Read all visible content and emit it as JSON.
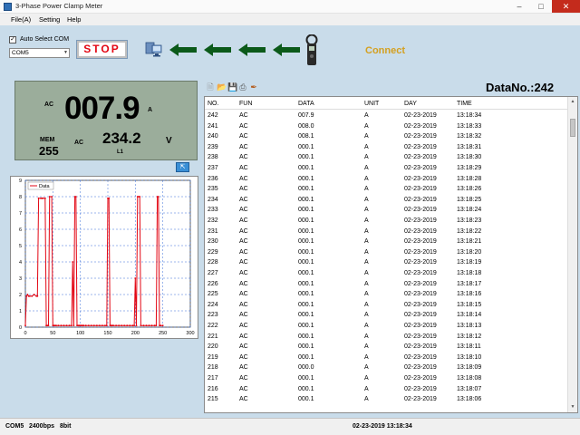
{
  "window": {
    "title": "3-Phase Power Clamp Meter",
    "minimize_icon": "minimize-icon",
    "maximize_icon": "maximize-icon",
    "close_icon": "close-icon"
  },
  "menu": [
    "File(A)",
    "Setting",
    "Help"
  ],
  "toolbar": {
    "auto_select_label": "Auto Select COM",
    "auto_select_checked": true,
    "com_port": "COM5",
    "stop_label": "STOP",
    "connect_label": "Connect",
    "accent_red": "#e30613",
    "arrow_color": "#0b5a1a",
    "connect_color": "#d4a020"
  },
  "meter": {
    "mode": "AC",
    "main_value": "007.9",
    "main_unit": "A",
    "mem_label": "MEM",
    "mem_value": "255",
    "sub_mode": "AC",
    "sub_value": "234.2",
    "sub_unit": "V",
    "phase": "L1"
  },
  "chart_data": {
    "type": "line",
    "legend": [
      "Data"
    ],
    "legend_position": "top-left",
    "xlim": [
      0,
      300
    ],
    "ylim": [
      0,
      9
    ],
    "xticks": [
      "0",
      "50",
      "100",
      "150",
      "200",
      "250",
      "300"
    ],
    "yticks": [
      "0",
      "1",
      "2",
      "3",
      "4",
      "5",
      "6",
      "7",
      "8",
      "9"
    ],
    "grid": true,
    "series": [
      {
        "name": "Data",
        "color": "#e30613",
        "x": [
          0,
          2,
          4,
          6,
          8,
          12,
          16,
          20,
          22,
          24,
          28,
          30,
          32,
          36,
          38,
          40,
          42,
          44,
          48,
          50,
          52,
          54,
          56,
          60,
          65,
          70,
          75,
          80,
          84,
          86,
          88,
          90,
          92,
          94,
          96,
          98,
          100,
          102,
          104,
          106,
          110,
          115,
          120,
          125,
          130,
          135,
          140,
          145,
          148,
          150,
          152,
          154,
          156,
          158,
          160,
          165,
          170,
          175,
          180,
          185,
          190,
          195,
          198,
          200,
          202,
          204,
          206,
          208,
          210,
          215,
          220,
          225,
          230,
          235,
          238,
          240,
          242,
          244,
          246,
          250
        ],
        "y": [
          0.1,
          1.9,
          2.0,
          1.9,
          1.9,
          1.9,
          2.0,
          1.9,
          1.9,
          7.9,
          7.9,
          7.9,
          7.9,
          7.9,
          0.1,
          0.1,
          0.1,
          8.0,
          8.0,
          0.1,
          0.1,
          0.1,
          0.1,
          0.1,
          0.1,
          0.1,
          0.1,
          0.1,
          0.1,
          4.0,
          0.1,
          8.0,
          8.0,
          0.1,
          0.1,
          0.1,
          0.1,
          0.1,
          0.1,
          0.1,
          0.1,
          0.1,
          0.1,
          0.1,
          0.1,
          0.1,
          0.1,
          0.1,
          0.1,
          7.9,
          7.9,
          0.1,
          0.1,
          0.1,
          0.1,
          0.1,
          0.1,
          0.1,
          0.1,
          0.1,
          0.1,
          0.1,
          0.1,
          3.0,
          0.1,
          8.0,
          8.0,
          8.0,
          0.1,
          0.1,
          0.1,
          0.1,
          0.1,
          0.1,
          0.1,
          8.0,
          8.0,
          0.1,
          0.1,
          0.1
        ]
      }
    ]
  },
  "table_toolbar_icons": [
    "new-icon",
    "open-icon",
    "save-icon",
    "print-icon",
    "clear-icon"
  ],
  "data_no": "DataNo.:242",
  "table": {
    "columns": [
      "NO.",
      "FUN",
      "DATA",
      "UNIT",
      "DAY",
      "TIME"
    ],
    "rows": [
      [
        "242",
        "AC",
        "007.9",
        "A",
        "02-23-2019",
        "13:18:34"
      ],
      [
        "241",
        "AC",
        "008.0",
        "A",
        "02-23-2019",
        "13:18:33"
      ],
      [
        "240",
        "AC",
        "008.1",
        "A",
        "02-23-2019",
        "13:18:32"
      ],
      [
        "239",
        "AC",
        "000.1",
        "A",
        "02-23-2019",
        "13:18:31"
      ],
      [
        "238",
        "AC",
        "000.1",
        "A",
        "02-23-2019",
        "13:18:30"
      ],
      [
        "237",
        "AC",
        "000.1",
        "A",
        "02-23-2019",
        "13:18:29"
      ],
      [
        "236",
        "AC",
        "000.1",
        "A",
        "02-23-2019",
        "13:18:28"
      ],
      [
        "235",
        "AC",
        "000.1",
        "A",
        "02-23-2019",
        "13:18:26"
      ],
      [
        "234",
        "AC",
        "000.1",
        "A",
        "02-23-2019",
        "13:18:25"
      ],
      [
        "233",
        "AC",
        "000.1",
        "A",
        "02-23-2019",
        "13:18:24"
      ],
      [
        "232",
        "AC",
        "000.1",
        "A",
        "02-23-2019",
        "13:18:23"
      ],
      [
        "231",
        "AC",
        "000.1",
        "A",
        "02-23-2019",
        "13:18:22"
      ],
      [
        "230",
        "AC",
        "000.1",
        "A",
        "02-23-2019",
        "13:18:21"
      ],
      [
        "229",
        "AC",
        "000.1",
        "A",
        "02-23-2019",
        "13:18:20"
      ],
      [
        "228",
        "AC",
        "000.1",
        "A",
        "02-23-2019",
        "13:18:19"
      ],
      [
        "227",
        "AC",
        "000.1",
        "A",
        "02-23-2019",
        "13:18:18"
      ],
      [
        "226",
        "AC",
        "000.1",
        "A",
        "02-23-2019",
        "13:18:17"
      ],
      [
        "225",
        "AC",
        "000.1",
        "A",
        "02-23-2019",
        "13:18:16"
      ],
      [
        "224",
        "AC",
        "000.1",
        "A",
        "02-23-2019",
        "13:18:15"
      ],
      [
        "223",
        "AC",
        "000.1",
        "A",
        "02-23-2019",
        "13:18:14"
      ],
      [
        "222",
        "AC",
        "000.1",
        "A",
        "02-23-2019",
        "13:18:13"
      ],
      [
        "221",
        "AC",
        "000.1",
        "A",
        "02-23-2019",
        "13:18:12"
      ],
      [
        "220",
        "AC",
        "000.1",
        "A",
        "02-23-2019",
        "13:18:11"
      ],
      [
        "219",
        "AC",
        "000.1",
        "A",
        "02-23-2019",
        "13:18:10"
      ],
      [
        "218",
        "AC",
        "000.0",
        "A",
        "02-23-2019",
        "13:18:09"
      ],
      [
        "217",
        "AC",
        "000.1",
        "A",
        "02-23-2019",
        "13:18:08"
      ],
      [
        "216",
        "AC",
        "000.1",
        "A",
        "02-23-2019",
        "13:18:07"
      ],
      [
        "215",
        "AC",
        "000.1",
        "A",
        "02-23-2019",
        "13:18:06"
      ]
    ]
  },
  "status": {
    "port": "COM5",
    "baud": "2400bps",
    "bits": "8bit",
    "datetime": "02-23-2019 13:18:34"
  }
}
